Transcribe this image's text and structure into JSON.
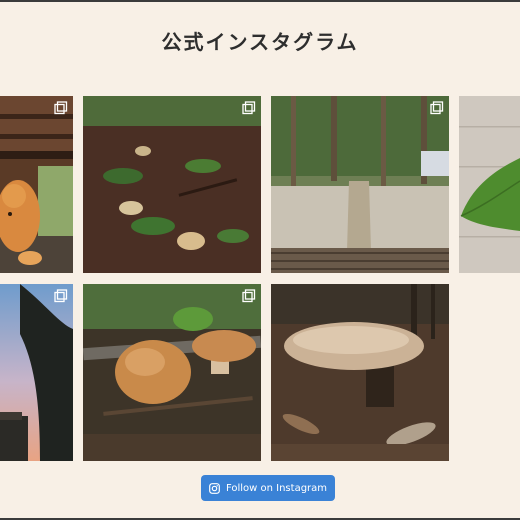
{
  "header": {
    "title": "公式インスタグラム"
  },
  "feed": {
    "tiles": [
      {
        "name": "cat-on-porch",
        "multi": true
      },
      {
        "name": "forest-floor-path",
        "multi": true
      },
      {
        "name": "forest-stairs",
        "multi": true
      },
      {
        "name": "green-leaf-on-wood",
        "multi": false
      },
      {
        "name": "sunset-trees",
        "multi": true
      },
      {
        "name": "brown-mushrooms",
        "multi": true
      },
      {
        "name": "pale-mushroom",
        "multi": false
      }
    ]
  },
  "follow_button": {
    "label": "Follow on Instagram",
    "icon": "instagram-icon"
  },
  "colors": {
    "background": "#f8f0e6",
    "button": "#3a82d6",
    "title": "#2e2e2e"
  }
}
